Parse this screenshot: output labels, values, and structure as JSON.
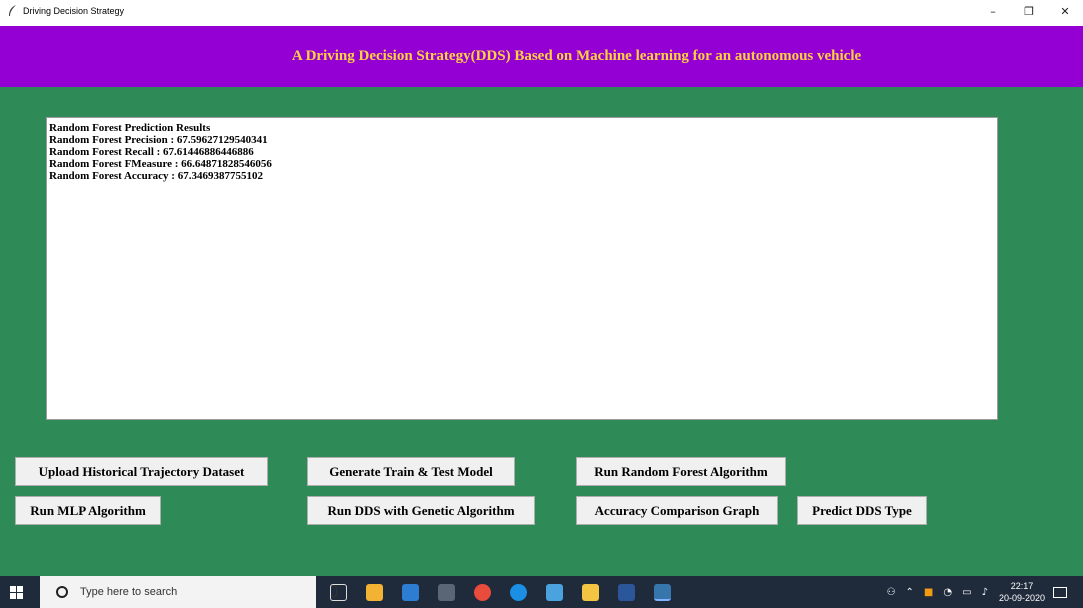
{
  "window": {
    "title": "Driving Decision Strategy",
    "minimize": "–",
    "restore": "❐",
    "close": "✕"
  },
  "banner": {
    "title": "A Driving Decision Strategy(DDS) Based on Machine learning for an autonomous vehicle"
  },
  "output": {
    "lines": [
      "Random Forest Prediction Results",
      "Random Forest Precision : 67.59627129540341",
      "Random Forest Recall : 67.61446886446886",
      "Random Forest FMeasure : 66.64871828546056",
      "Random Forest Accuracy : 67.3469387755102"
    ]
  },
  "buttons": {
    "upload": "Upload Historical Trajectory Dataset",
    "generate": "Generate Train & Test Model",
    "random_forest": "Run Random Forest Algorithm",
    "mlp": "Run MLP Algorithm",
    "dds_genetic": "Run DDS with Genetic Algorithm",
    "accuracy_graph": "Accuracy Comparison Graph",
    "predict": "Predict DDS Type"
  },
  "taskbar": {
    "search_placeholder": "Type here to search",
    "time": "22:17",
    "date": "20-09-2020"
  },
  "colors": {
    "banner_bg": "#9400d3",
    "banner_text": "#ffd23f",
    "main_bg": "#2e8b57",
    "taskbar_bg": "#1f2a3a"
  }
}
